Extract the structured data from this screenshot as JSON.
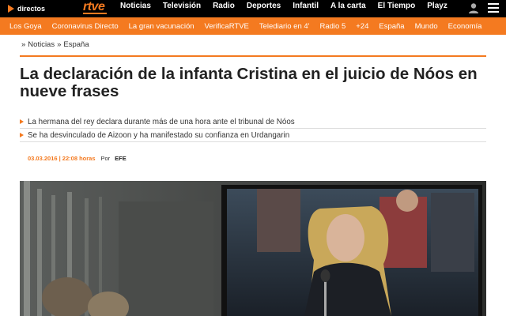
{
  "topbar": {
    "directos_label": "directos",
    "logo": "rtve",
    "nav": [
      "Noticias",
      "Televisión",
      "Radio",
      "Deportes",
      "Infantil",
      "A la carta",
      "El Tiempo",
      "Playz"
    ]
  },
  "subnav": [
    "Los Goya",
    "Coronavirus Directo",
    "La gran vacunación",
    "VerificaRTVE",
    "Telediario en 4'",
    "Radio 5",
    "+24",
    "España",
    "Mundo",
    "Economía"
  ],
  "breadcrumb": [
    "Noticias",
    "España"
  ],
  "breadcrumb_separator": "»",
  "article": {
    "title": "La declaración de la infanta Cristina en el juicio de Nóos en nueve frases",
    "summary": [
      "La hermana del rey declara durante más de una hora ante el tribunal de Nóos",
      "Se ha desvinculado de Aizoon y ha manifestado su confianza en Urdangarin"
    ],
    "date": "03.03.2016 | 22:08 horas",
    "by_label": "Por",
    "agency": "EFE"
  },
  "colors": {
    "accent": "#f47a20",
    "topbar": "#000000"
  }
}
